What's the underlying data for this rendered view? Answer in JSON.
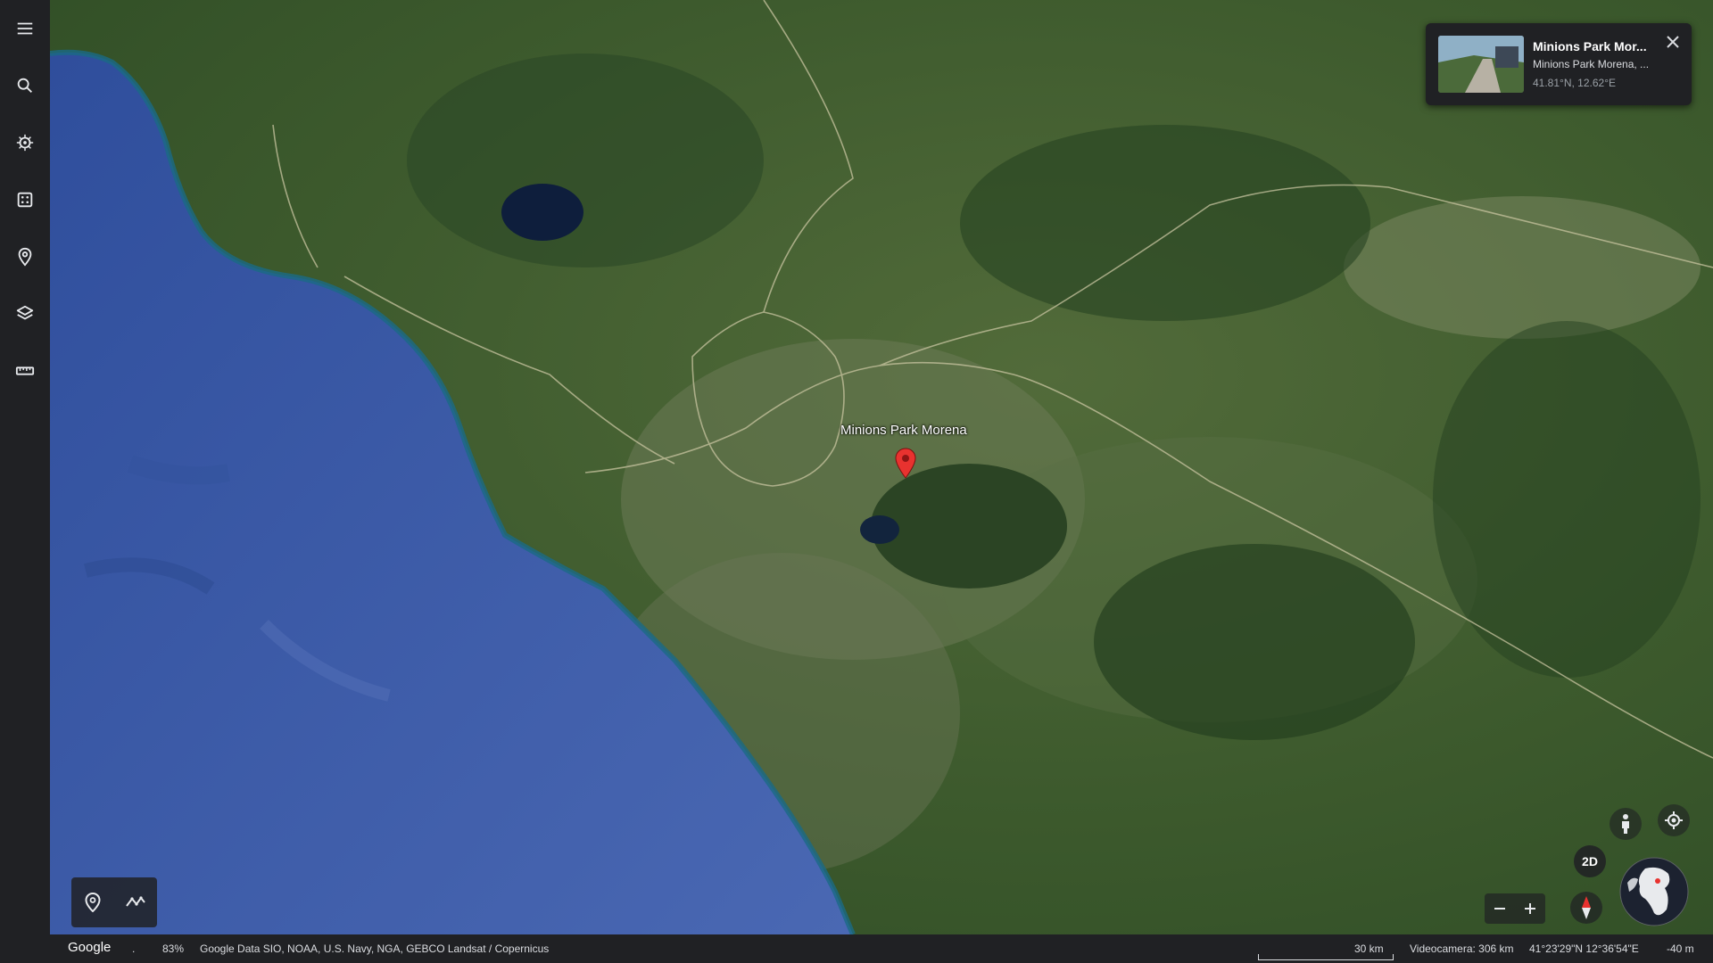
{
  "sidebar": {
    "items": [
      {
        "icon": "menu-icon"
      },
      {
        "icon": "search-icon"
      },
      {
        "icon": "voyager-icon"
      },
      {
        "icon": "feeling-lucky-icon"
      },
      {
        "icon": "projects-icon"
      },
      {
        "icon": "map-style-icon"
      },
      {
        "icon": "measure-icon"
      }
    ]
  },
  "map": {
    "place_label": "Minions Park Morena",
    "colors": {
      "sea": "#3f5fa8",
      "land": "#3c5a2c",
      "pin": "#e8322f"
    }
  },
  "info_card": {
    "title": "Minions Park Mor...",
    "subtitle": "Minions Park Morena, ...",
    "coords": "41.81°N, 12.62°E"
  },
  "status_bar": {
    "brand": "Google",
    "separator": ".",
    "zoom_pct": "83%",
    "attribution": "Google  Data SIO, NOAA, U.S. Navy, NGA, GEBCO  Landsat / Copernicus",
    "scale": "30 km",
    "camera": "Videocamera: 306 km",
    "coords": "41°23'29\"N 12°36'54\"E",
    "elevation": "-40 m"
  },
  "controls": {
    "mode_2d": "2D"
  }
}
